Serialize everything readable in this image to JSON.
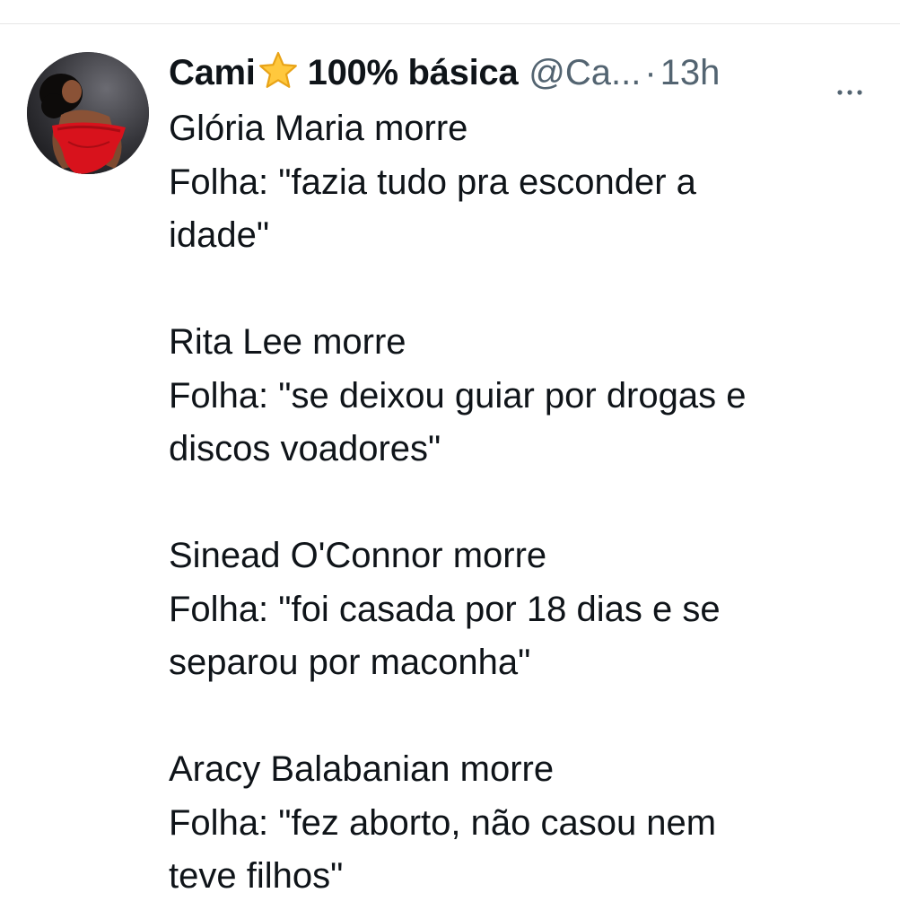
{
  "tweet": {
    "author": {
      "name_part1": "Cami",
      "emoji_icon": "star-icon",
      "name_part2": "100% básica",
      "handle": "@Ca...",
      "separator": "·",
      "time": "13h"
    },
    "more_icon": "more-horizontal-icon",
    "paragraphs": [
      [
        "Glória Maria morre",
        "Folha: \"fazia tudo pra esconder a",
        "idade\""
      ],
      [
        "Rita Lee morre",
        "Folha: \"se deixou guiar por drogas e",
        "discos voadores\""
      ],
      [
        "Sinead O'Connor morre",
        "Folha: \"foi casada por 18 dias e se",
        "separou por maconha\""
      ],
      [
        "Aracy Balabanian morre",
        "Folha: \"fez aborto, não casou nem",
        "teve filhos\""
      ]
    ]
  },
  "colors": {
    "text_primary": "#0f1419",
    "text_secondary": "#536471",
    "star": "#ffc83d"
  }
}
